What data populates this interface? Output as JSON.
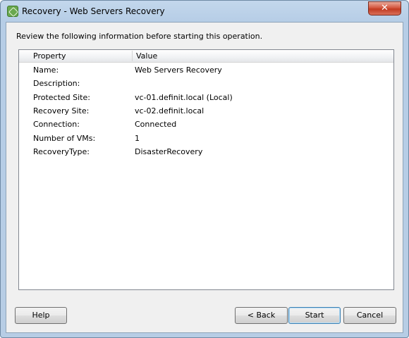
{
  "window": {
    "title": "Recovery - Web Servers Recovery",
    "close_glyph": "✕"
  },
  "intro_text": "Review the following information before starting this operation.",
  "table": {
    "columns": [
      "Property",
      "Value"
    ],
    "rows": [
      {
        "property": "Name:",
        "value": "Web Servers Recovery"
      },
      {
        "property": "Description:",
        "value": ""
      },
      {
        "property": "Protected Site:",
        "value": "vc-01.definit.local (Local)"
      },
      {
        "property": "Recovery Site:",
        "value": "vc-02.definit.local"
      },
      {
        "property": "Connection:",
        "value": "Connected"
      },
      {
        "property": "Number of VMs:",
        "value": "1"
      },
      {
        "property": "RecoveryType:",
        "value": "DisasterRecovery"
      }
    ]
  },
  "buttons": {
    "help": "Help",
    "back": "< Back",
    "start": "Start",
    "cancel": "Cancel"
  }
}
